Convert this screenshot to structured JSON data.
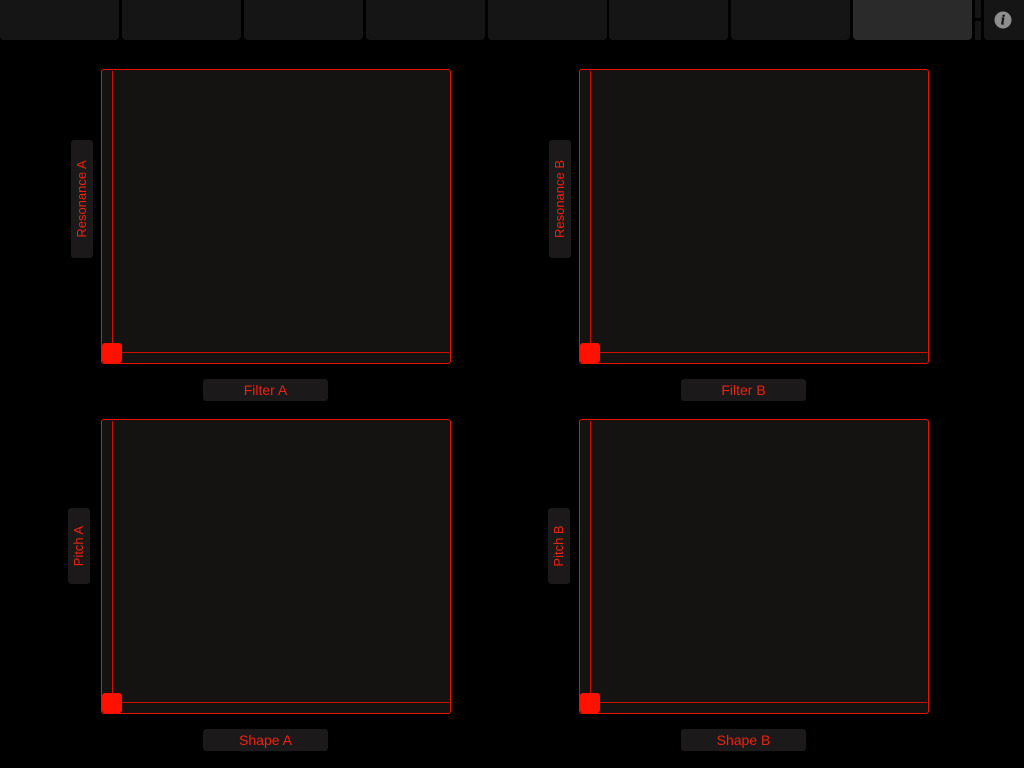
{
  "colors": {
    "accent": "#ff1100",
    "label_text": "#ee2211",
    "pad_bg": "#151212",
    "tab_bg": "#151515",
    "tab_active_bg": "#2a2a2a"
  },
  "tabs": {
    "count": 8,
    "active_index": 7,
    "labels": [
      "",
      "",
      "",
      "",
      "",
      "",
      "",
      ""
    ]
  },
  "info_button": {
    "icon": "info-icon",
    "glyph": "i"
  },
  "pads": [
    {
      "id": "a-top",
      "x_label": "Filter A",
      "y_label": "Resonance A",
      "x_value": 0.0,
      "y_value": 0.0
    },
    {
      "id": "b-top",
      "x_label": "Filter B",
      "y_label": "Resonance B",
      "x_value": 0.0,
      "y_value": 0.0
    },
    {
      "id": "a-bottom",
      "x_label": "Shape A",
      "y_label": "Pitch A",
      "x_value": 0.0,
      "y_value": 0.0
    },
    {
      "id": "b-bottom",
      "x_label": "Shape B",
      "y_label": "Pitch B",
      "x_value": 0.0,
      "y_value": 0.0
    }
  ]
}
